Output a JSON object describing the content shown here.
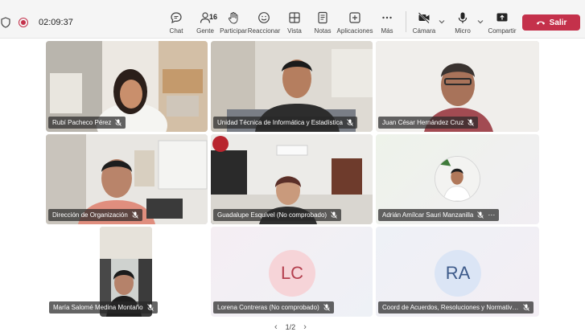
{
  "status": {
    "timer": "02:09:37"
  },
  "toolbar": {
    "items": [
      {
        "label": "Chat",
        "icon": "chat-icon"
      },
      {
        "label": "Gente",
        "icon": "people-icon",
        "count": "16"
      },
      {
        "label": "Participar",
        "icon": "raise-hand-icon"
      },
      {
        "label": "Reaccionar",
        "icon": "emoji-icon"
      },
      {
        "label": "Vista",
        "icon": "grid-view-icon"
      },
      {
        "label": "Notas",
        "icon": "notes-icon"
      },
      {
        "label": "Aplicaciones",
        "icon": "add-apps-icon"
      },
      {
        "label": "Más",
        "icon": "more-icon"
      },
      {
        "label": "Cámara",
        "icon": "camera-off-icon"
      },
      {
        "label": "Micro",
        "icon": "mic-icon"
      },
      {
        "label": "Compartir",
        "icon": "share-icon"
      }
    ],
    "leave_label": "Salir"
  },
  "participants": [
    {
      "name": "Rubí Pacheco Pérez"
    },
    {
      "name": "Unidad Técnica de Informática y Estadística"
    },
    {
      "name": "Juan César Hernández Cruz"
    },
    {
      "name": "Dirección de Organización"
    },
    {
      "name": "Guadalupe Esquivel (No comprobado)"
    },
    {
      "name": "Adrián Amílcar Sauri Manzanilla"
    },
    {
      "name": "María Salomé Medina Montaño"
    },
    {
      "name": "Lorena Contreras (No comprobado)",
      "initials": "LC"
    },
    {
      "name": "Coord de Acuerdos, Resoluciones y Normatividad",
      "initials": "RA"
    }
  ],
  "pager": {
    "text": "1/2"
  },
  "colors": {
    "leave": "#c4314b",
    "lc_avatar": "#f6d4d8",
    "ra_avatar": "#dbe5f5"
  }
}
